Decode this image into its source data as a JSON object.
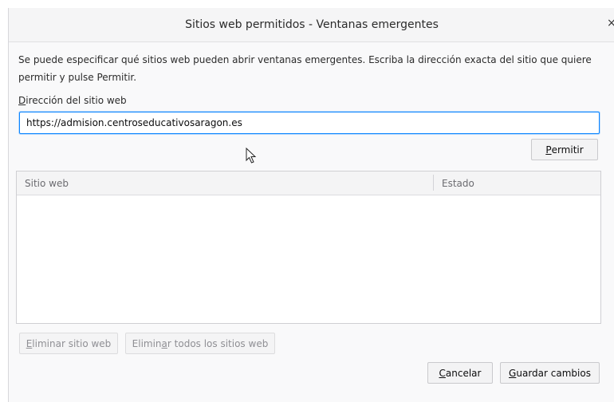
{
  "dialog": {
    "title": "Sitios web permitidos - Ventanas emergentes",
    "close_glyph": "×"
  },
  "description": "Se puede especificar qué sitios web pueden abrir ventanas emergentes. Escriba la dirección exacta del sitio que quiere permitir y pulse Permitir.",
  "address": {
    "label_access_key": "D",
    "label_rest": "irección del sitio web",
    "value": "https://admision.centroseducativosaragon.es"
  },
  "buttons": {
    "permit": {
      "key": "P",
      "rest": "ermitir"
    },
    "remove": {
      "key": "E",
      "rest": "liminar sitio web"
    },
    "remove_all": {
      "pre": "Elimin",
      "key": "a",
      "rest": "r todos los sitios web"
    },
    "cancel": {
      "key": "C",
      "rest": "ancelar"
    },
    "save": {
      "key": "G",
      "rest": "uardar cambios"
    }
  },
  "table": {
    "columns": [
      "Sitio web",
      "Estado"
    ],
    "rows": []
  },
  "colors": {
    "focus_accent": "#0a84ff",
    "dialog_bg": "#f9f9fa"
  }
}
